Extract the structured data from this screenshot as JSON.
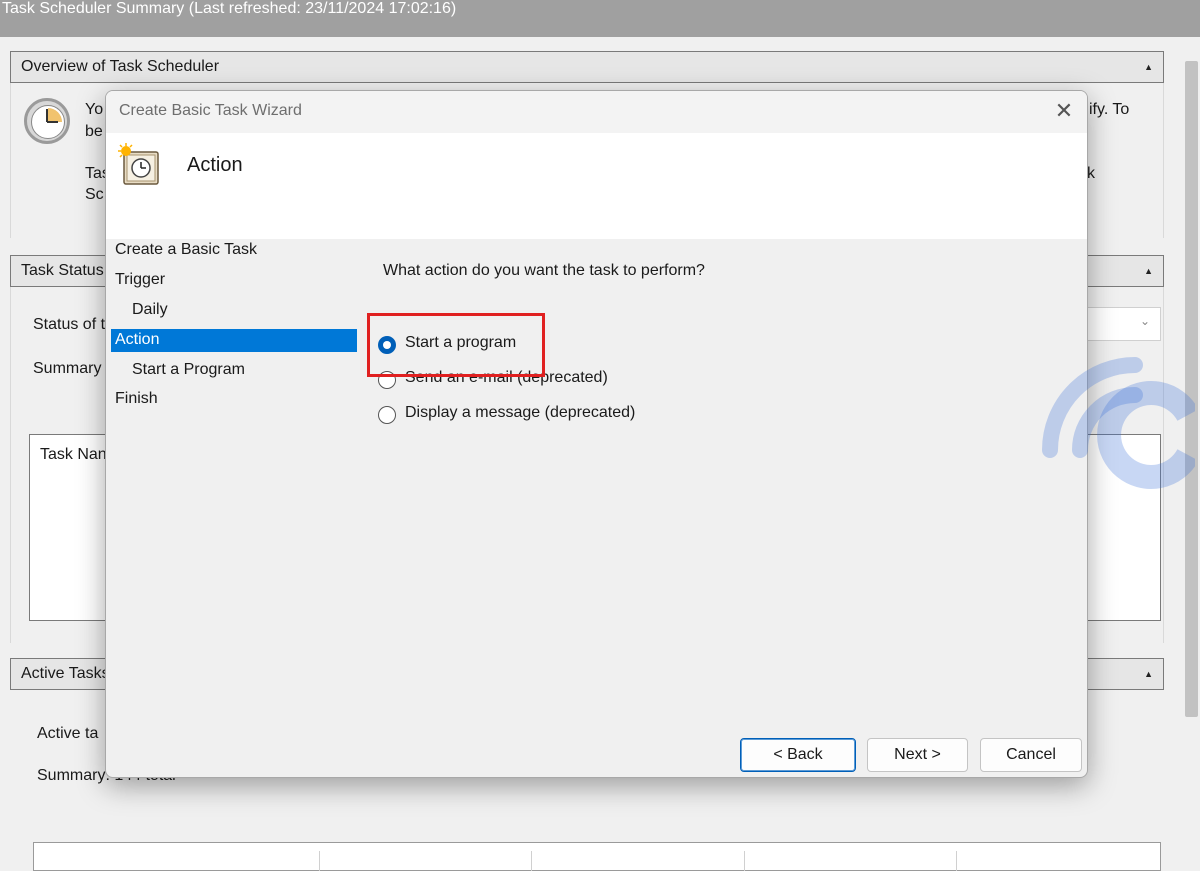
{
  "window": {
    "title": "Task Scheduler Summary (Last refreshed: 23/11/2024 17:02:16)"
  },
  "background": {
    "overview": {
      "heading": "Overview of Task Scheduler",
      "line1_left": "Yo",
      "line1_right": "ify. To",
      "line2_left": "be",
      "line3_left": "Tas",
      "line3_right": "k",
      "line4_left": "Sc"
    },
    "task_status": {
      "heading": "Task Status",
      "status_label": "Status of t",
      "summary_label": "Summary",
      "list_header": "Task Nan"
    },
    "active_tasks": {
      "heading": "Active Tasks",
      "active_label": "Active ta",
      "summary_label": "Summary: 144 total"
    }
  },
  "dialog": {
    "title": "Create Basic Task Wizard",
    "close_glyph": "✕",
    "header_title": "Action",
    "steps": [
      {
        "label": "Create a Basic Task",
        "sub": false,
        "active": false
      },
      {
        "label": "Trigger",
        "sub": false,
        "active": false
      },
      {
        "label": "Daily",
        "sub": true,
        "active": false
      },
      {
        "label": "Action",
        "sub": false,
        "active": true
      },
      {
        "label": "Start a Program",
        "sub": true,
        "active": false
      },
      {
        "label": "Finish",
        "sub": false,
        "active": false
      }
    ],
    "question": "What action do you want the task to perform?",
    "options": [
      {
        "label": "Start a program",
        "checked": true
      },
      {
        "label": "Send an e-mail (deprecated)",
        "checked": false
      },
      {
        "label": "Display a message (deprecated)",
        "checked": false
      }
    ],
    "buttons": {
      "back": "< Back",
      "next": "Next >",
      "cancel": "Cancel"
    }
  },
  "colors": {
    "accent": "#0078d7",
    "highlight": "#e02020",
    "watermark": "#3a6fd8"
  },
  "icons": {
    "wizard": "task-wizard-clock-icon",
    "overview": "clock-icon",
    "close": "close-icon",
    "collapse": "collapse-arrow-icon"
  }
}
